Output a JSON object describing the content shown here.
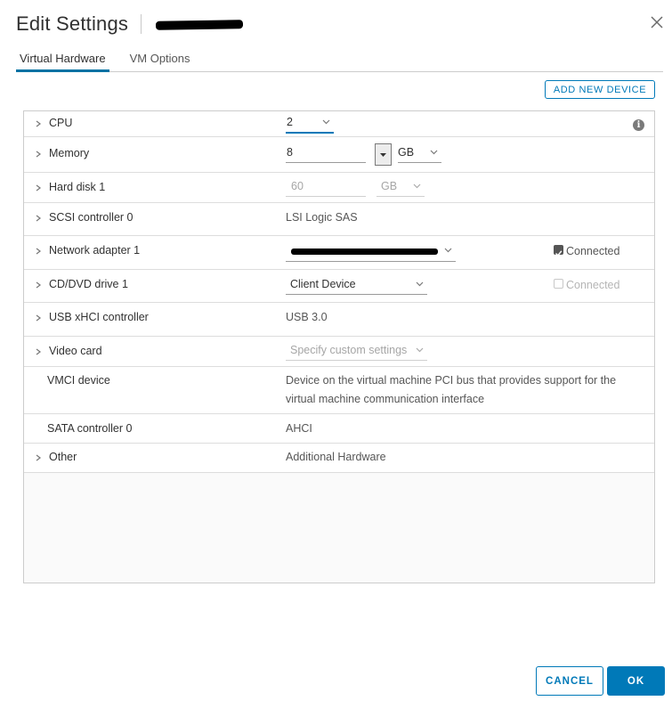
{
  "dialog": {
    "title": "Edit Settings",
    "add_device_label": "ADD NEW DEVICE",
    "cancel_label": "CANCEL",
    "ok_label": "OK"
  },
  "tabs": [
    {
      "label": "Virtual Hardware",
      "active": true
    },
    {
      "label": "VM Options",
      "active": false
    }
  ],
  "devices": {
    "cpu": {
      "label": "CPU",
      "value": "2"
    },
    "memory": {
      "label": "Memory",
      "value": "8",
      "unit": "GB"
    },
    "hard_disk": {
      "label": "Hard disk 1",
      "value": "60",
      "unit": "GB"
    },
    "scsi": {
      "label": "SCSI controller 0",
      "value": "LSI Logic SAS"
    },
    "network": {
      "label": "Network adapter 1",
      "connected_label": "Connected",
      "connected": true
    },
    "cddvd": {
      "label": "CD/DVD drive 1",
      "value": "Client Device",
      "connected_label": "Connected",
      "connected": false
    },
    "usb": {
      "label": "USB xHCI controller",
      "value": "USB 3.0"
    },
    "video": {
      "label": "Video card",
      "value": "Specify custom settings"
    },
    "vmci": {
      "label": "VMCI device",
      "value_line1": "Device on the virtual machine PCI bus that provides support for the",
      "value_line2": "virtual machine communication interface"
    },
    "sata": {
      "label": "SATA controller 0",
      "value": "AHCI"
    },
    "other": {
      "label": "Other",
      "value": "Additional Hardware"
    }
  },
  "icons": {
    "close": "close-icon",
    "expand": "chevron-right-icon",
    "dropdown": "chevron-down-icon",
    "info": "info-icon"
  },
  "colors": {
    "accent": "#0079b8",
    "text": "#313131",
    "border": "#cccccc"
  }
}
